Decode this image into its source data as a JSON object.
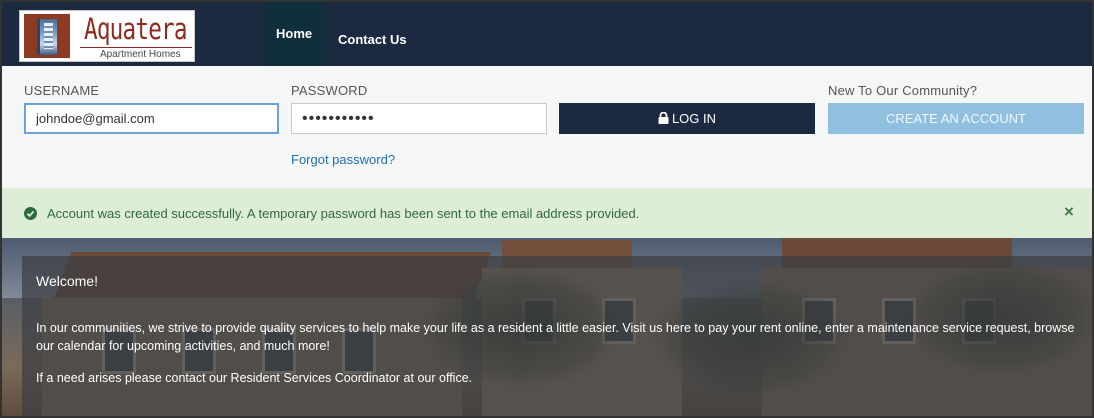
{
  "brand": {
    "name": "Aquatera",
    "tagline": "Apartment Homes",
    "primary_color": "#1b2a40",
    "accent_color": "#8fc0df",
    "logo_color": "#8e2a1f"
  },
  "nav": {
    "items": [
      {
        "label": "Home",
        "active": true
      },
      {
        "label": "Contact Us",
        "active": false
      }
    ]
  },
  "login": {
    "username_label": "USERNAME",
    "username_value": "johndoe@gmail.com",
    "password_label": "PASSWORD",
    "password_value": "•••••••••••",
    "login_button": "LOG IN",
    "forgot_link": "Forgot password?",
    "new_label": "New To Our Community?",
    "create_button": "CREATE AN ACCOUNT"
  },
  "alert": {
    "type": "success",
    "icon": "check-circle-icon",
    "message": "Account was created successfully. A temporary password has been sent to the email address provided.",
    "close": "×"
  },
  "hero": {
    "welcome_title": "Welcome!",
    "paragraph1": "In our communities, we strive to provide quality services to help make your life as a resident a little easier. Visit us here to pay your rent online, enter a maintenance service request, browse our calendar for upcoming activities, and much more!",
    "paragraph2": "If a need arises please contact our Resident Services Coordinator at our office."
  }
}
